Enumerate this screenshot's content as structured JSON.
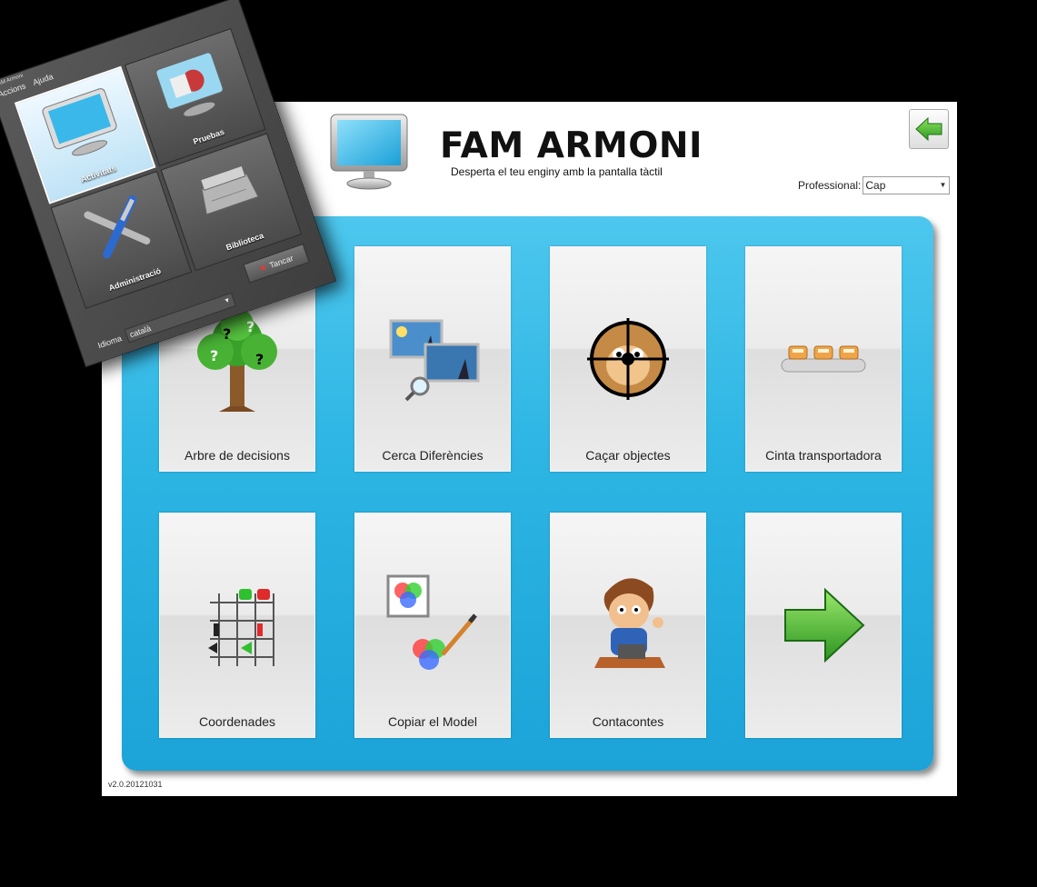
{
  "app": {
    "title": "FAM ARMONI",
    "subtitle": "Desperta el teu enginy amb la pantalla tàctil",
    "professional_label": "Professional:",
    "professional_value": "Cap",
    "version": "v2.0.20121031"
  },
  "tiles": [
    {
      "label": "Arbre de decisions",
      "icon": "decision-tree-icon"
    },
    {
      "label": "Cerca Diferències",
      "icon": "find-differences-icon"
    },
    {
      "label": "Caçar objectes",
      "icon": "hunt-objects-icon"
    },
    {
      "label": "Cinta transportadora",
      "icon": "conveyor-belt-icon"
    },
    {
      "label": "Coordenades",
      "icon": "coordinates-icon"
    },
    {
      "label": "Copiar el Model",
      "icon": "copy-model-icon"
    },
    {
      "label": "Contacontes",
      "icon": "storyteller-icon"
    },
    {
      "label": "",
      "icon": "next-arrow-icon"
    }
  ],
  "overlay": {
    "window_title": "FAM Armoni",
    "menu": [
      "Accions",
      "Ajuda"
    ],
    "cells": [
      {
        "label": "Activitats",
        "icon": "monitor-icon",
        "selected": true
      },
      {
        "label": "Pruebas",
        "icon": "tests-icon",
        "selected": false
      },
      {
        "label": "Administració",
        "icon": "tools-icon",
        "selected": false
      },
      {
        "label": "Biblioteca",
        "icon": "library-icon",
        "selected": false
      }
    ],
    "close_label": "Tancar",
    "language_label": "Idioma",
    "language_value": "català"
  },
  "colors": {
    "panel_blue": "#2cb4e3",
    "arrow_green": "#3aa82c",
    "title_black": "#111111"
  }
}
